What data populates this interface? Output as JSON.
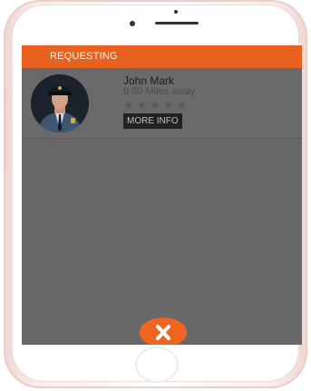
{
  "header": {
    "title": "REQUESTING"
  },
  "driver": {
    "name": "John Mark",
    "distance": "0.00 Miles away",
    "rating": 0,
    "stars": "★★★★★",
    "more_info_label": "MORE INFO"
  },
  "colors": {
    "accent": "#e7611f",
    "overlay": "#686868",
    "button_dark": "#222222"
  },
  "icons": {
    "cancel": "close-icon",
    "avatar": "driver-avatar"
  }
}
